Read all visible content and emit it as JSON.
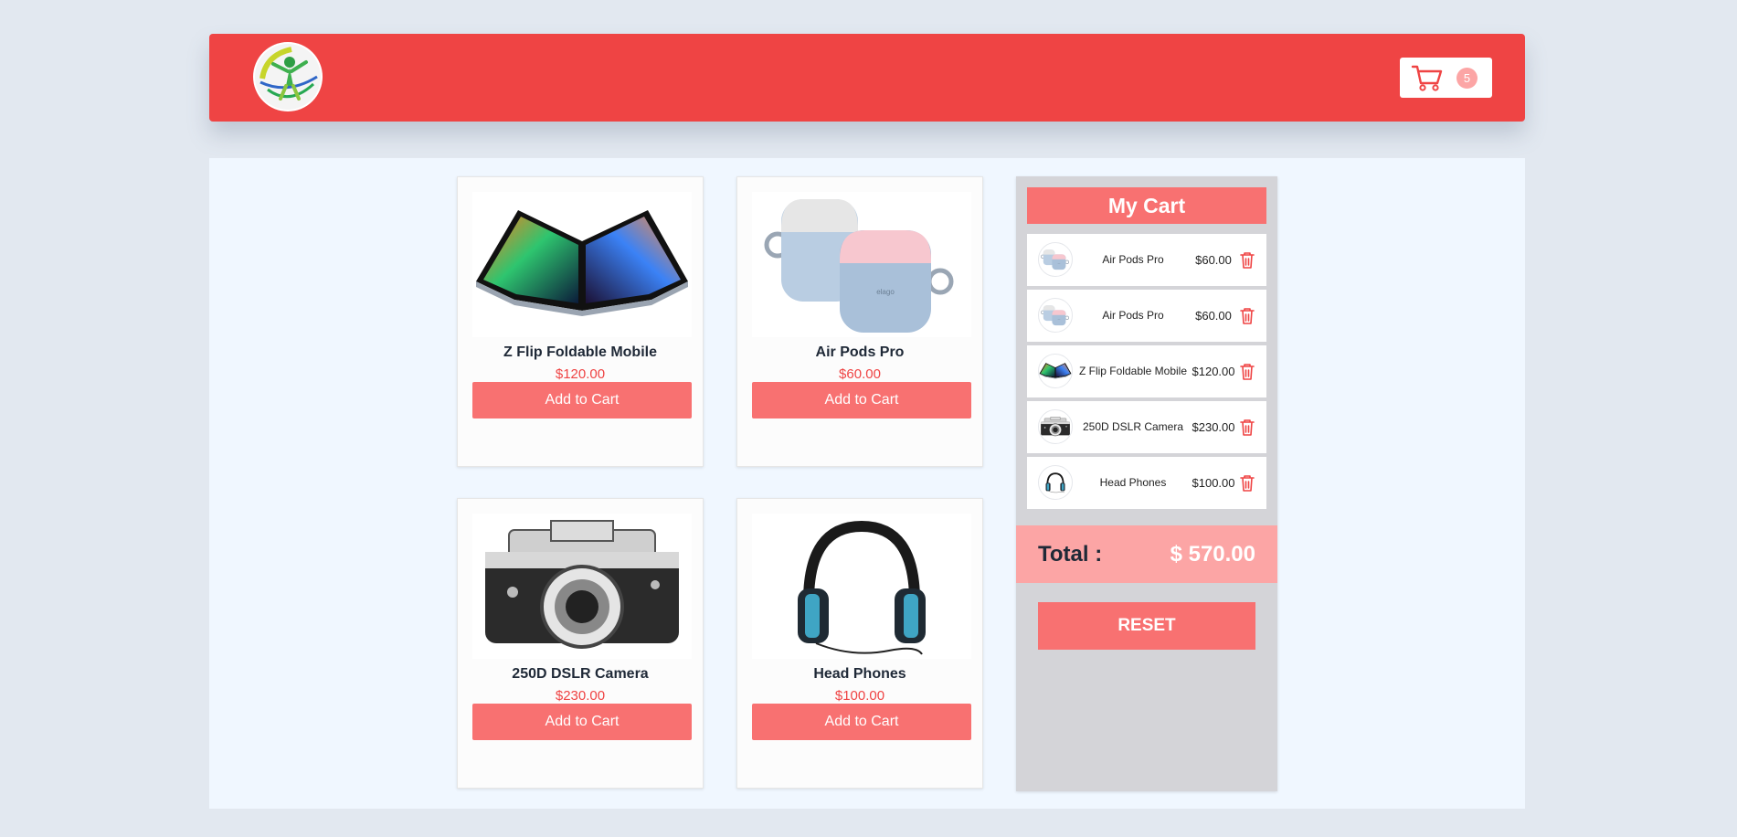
{
  "header": {
    "logo": "leaf-person-logo",
    "cart_icon": "shopping-cart-icon",
    "cart_count": "5"
  },
  "products": [
    {
      "name": "Z Flip Foldable Mobile",
      "price": "$120.00",
      "button": "Add to Cart",
      "image": "foldable-phone-image"
    },
    {
      "name": "Air Pods Pro",
      "price": "$60.00",
      "button": "Add to Cart",
      "image": "airpods-image"
    },
    {
      "name": "250D DSLR Camera",
      "price": "$230.00",
      "button": "Add to Cart",
      "image": "camera-image"
    },
    {
      "name": "Head Phones",
      "price": "$100.00",
      "button": "Add to Cart",
      "image": "headphones-image"
    }
  ],
  "cart": {
    "title": "My Cart",
    "items": [
      {
        "name": "Air Pods Pro",
        "price": "$60.00",
        "thumb": "airpods-thumb"
      },
      {
        "name": "Air Pods Pro",
        "price": "$60.00",
        "thumb": "airpods-thumb"
      },
      {
        "name": "Z Flip Foldable Mobile",
        "price": "$120.00",
        "thumb": "foldable-phone-thumb"
      },
      {
        "name": "250D DSLR Camera",
        "price": "$230.00",
        "thumb": "camera-thumb"
      },
      {
        "name": "Head Phones",
        "price": "$100.00",
        "thumb": "headphones-thumb"
      }
    ],
    "delete_icon": "trash-icon",
    "total_label": "Total :",
    "total_value": "$ 570.00",
    "reset_label": "RESET"
  },
  "colors": {
    "primary": "#ef4444",
    "accent": "#f87171",
    "light_accent": "#fca5a5",
    "page_bg": "#e2e8f0",
    "content_bg": "#f0f7ff",
    "cart_panel_bg": "#d4d4d8"
  }
}
